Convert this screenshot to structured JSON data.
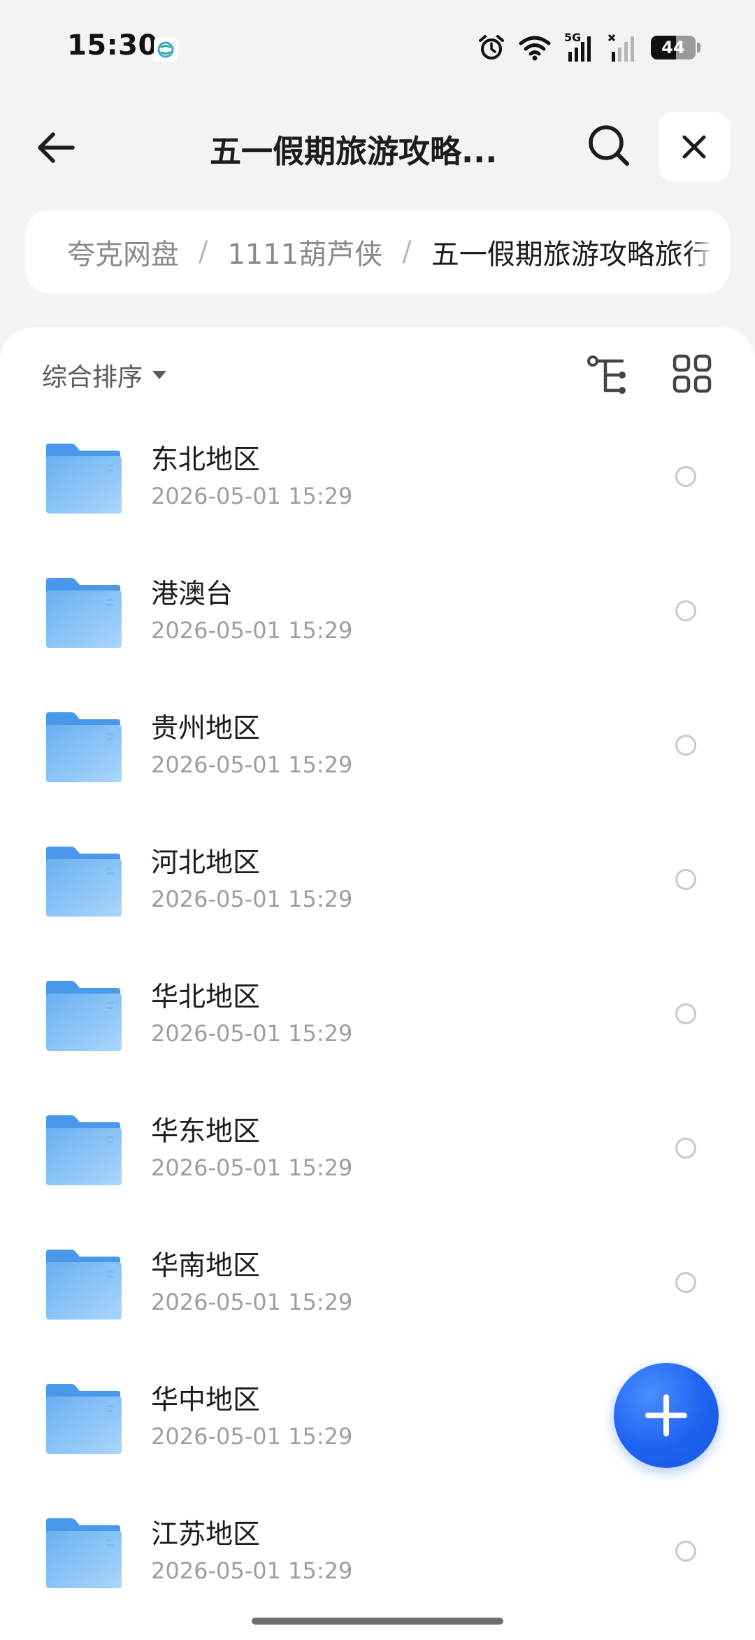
{
  "status_bar": {
    "time": "15:30",
    "network_label": "5G",
    "battery": "44"
  },
  "header": {
    "title": "五一假期旅游攻略...",
    "back_icon": "arrow-left-icon",
    "search_icon": "search-icon",
    "close_icon": "close-icon"
  },
  "breadcrumb": {
    "items": [
      {
        "label": "夸克网盘"
      },
      {
        "label": "1111葫芦侠"
      },
      {
        "label": "五一假期旅游攻略旅行"
      }
    ],
    "separator": "/"
  },
  "toolbar": {
    "sort_label": "综合排序",
    "tree_icon": "tree-view-icon",
    "grid_icon": "grid-view-icon"
  },
  "files": [
    {
      "name": "东北地区",
      "date": "2026-05-01 15:29"
    },
    {
      "name": "港澳台",
      "date": "2026-05-01 15:29"
    },
    {
      "name": "贵州地区",
      "date": "2026-05-01 15:29"
    },
    {
      "name": "河北地区",
      "date": "2026-05-01 15:29"
    },
    {
      "name": "华北地区",
      "date": "2026-05-01 15:29"
    },
    {
      "name": "华东地区",
      "date": "2026-05-01 15:29"
    },
    {
      "name": "华南地区",
      "date": "2026-05-01 15:29"
    },
    {
      "name": "华中地区",
      "date": "2026-05-01 15:29"
    },
    {
      "name": "江苏地区",
      "date": "2026-05-01 15:29"
    }
  ],
  "fab": {
    "icon": "plus-icon"
  },
  "colors": {
    "accent": "#1e63f0",
    "folder": "#6fb6f5",
    "background": "#f3f3f5"
  }
}
